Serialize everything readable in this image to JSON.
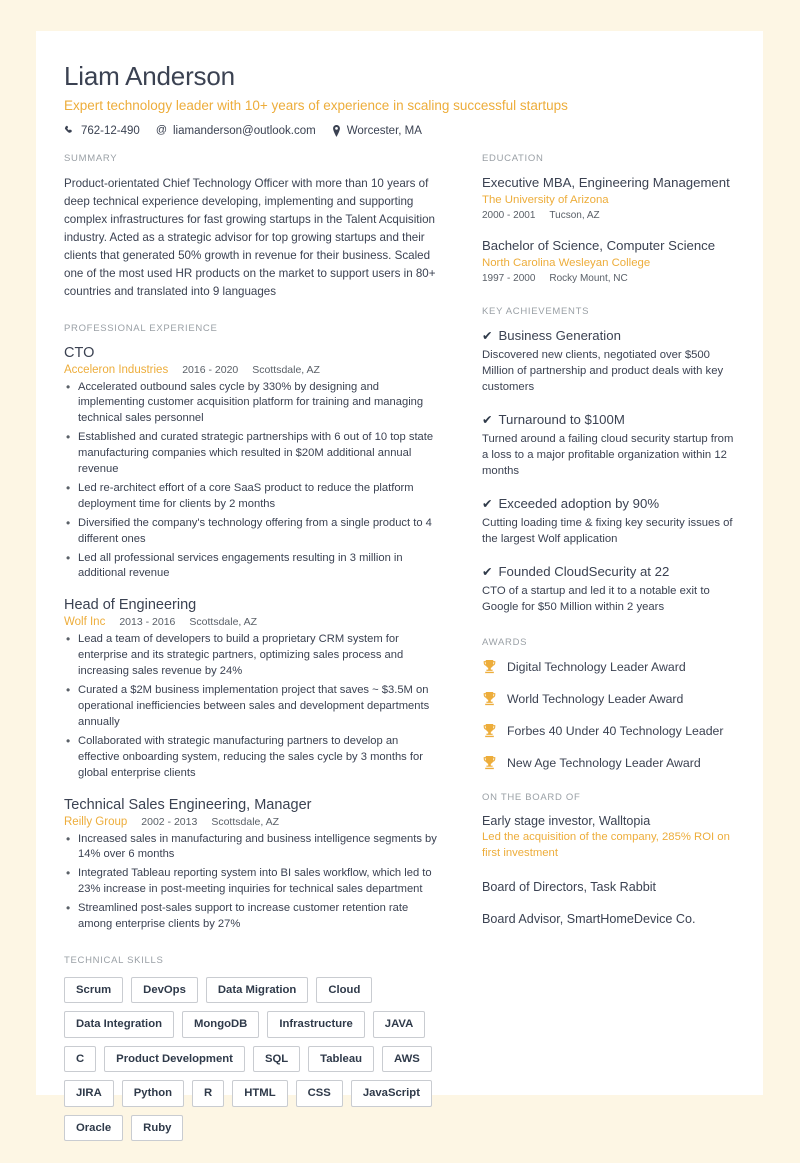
{
  "theme": {
    "page_background": "#fdf6e4",
    "card_background": "#ffffff",
    "accent": "#edad3b",
    "text": "#3b4252",
    "muted": "#9aa0a6"
  },
  "header": {
    "name": "Liam Anderson",
    "headline": "Expert technology leader with 10+ years of experience in scaling successful startups",
    "contacts": [
      {
        "icon": "phone-icon",
        "value": "762-12-490"
      },
      {
        "icon": "email-icon",
        "value": "liamanderson@outlook.com"
      },
      {
        "icon": "location-pin-icon",
        "value": "Worcester, MA"
      }
    ]
  },
  "left": {
    "summary": {
      "title": "SUMMARY",
      "text": "Product-orientated Chief Technology Officer with more than 10 years of deep technical experience developing, implementing and supporting complex infrastructures for fast growing startups in the Talent Acquisition industry. Acted as a strategic advisor for top growing startups and their clients that generated 50% growth in revenue for their business. Scaled one of the most used HR products on the market to support users in 80+ countries and translated into 9 languages"
    },
    "experience": {
      "title": "PROFESSIONAL EXPERIENCE",
      "jobs": [
        {
          "role": "CTO",
          "company": "Acceleron Industries",
          "dates": "2016 - 2020",
          "location": "Scottsdale, AZ",
          "bullets": [
            "Accelerated outbound sales cycle by 330% by designing and implementing customer acquisition platform for training and managing technical sales personnel",
            "Established and curated strategic partnerships with 6 out of 10 top state manufacturing companies which resulted in $20M additional annual revenue",
            "Led re-architect effort of a core SaaS product to reduce the platform deployment time for clients by 2 months",
            "Diversified the company's technology offering from a single product to 4 different ones",
            "Led all professional services engagements resulting in 3 million in additional revenue"
          ]
        },
        {
          "role": "Head of Engineering",
          "company": "Wolf Inc",
          "dates": "2013 - 2016",
          "location": "Scottsdale, AZ",
          "bullets": [
            "Lead a team of developers to build a proprietary CRM system for enterprise and its strategic partners, optimizing sales process and increasing sales revenue by 24%",
            "Curated a $2M business implementation project that saves ~ $3.5M on operational inefficiencies between sales and development departments annually",
            "Collaborated with strategic manufacturing partners to develop an effective onboarding system, reducing the sales cycle by 3 months for global enterprise clients"
          ]
        },
        {
          "role": "Technical Sales Engineering, Manager",
          "company": "Reilly Group",
          "dates": "2002 - 2013",
          "location": "Scottsdale, AZ",
          "bullets": [
            "Increased sales in manufacturing and business intelligence segments by 14% over 6 months",
            "Integrated Tableau reporting system into BI sales workflow, which led to 23% increase in post-meeting inquiries for technical sales department",
            "Streamlined post-sales support to increase customer retention rate among enterprise clients by 27%"
          ]
        }
      ]
    },
    "skills": {
      "title": "TECHNICAL SKILLS",
      "tags": [
        "Scrum",
        "DevOps",
        "Data Migration",
        "Cloud",
        "Data Integration",
        "MongoDB",
        "Infrastructure",
        "JAVA",
        "C",
        "Product Development",
        "SQL",
        "Tableau",
        "AWS",
        "JIRA",
        "Python",
        "R",
        "HTML",
        "CSS",
        "JavaScript",
        "Oracle",
        "Ruby"
      ]
    }
  },
  "right": {
    "education": {
      "title": "EDUCATION",
      "items": [
        {
          "degree": "Executive MBA, Engineering Management",
          "school": "The University of Arizona",
          "dates": "2000 - 2001",
          "location": "Tucson, AZ"
        },
        {
          "degree": "Bachelor of Science, Computer Science",
          "school": "North Carolina Wesleyan College",
          "dates": "1997 - 2000",
          "location": "Rocky Mount, NC"
        }
      ]
    },
    "achievements": {
      "title": "KEY ACHIEVEMENTS",
      "check_glyph": "✔",
      "items": [
        {
          "title": "Business Generation",
          "desc": "Discovered new clients, negotiated over $500 Million of partnership and product deals with key customers"
        },
        {
          "title": "Turnaround to $100M",
          "desc": "Turned around a failing cloud security startup from a loss to a major profitable organization within 12 months"
        },
        {
          "title": "Exceeded adoption by 90%",
          "desc": "Cutting loading time & fixing key security issues of the largest Wolf application"
        },
        {
          "title": "Founded CloudSecurity at 22",
          "desc": "CTO of a startup and led it to a notable exit to Google for $50 Million within 2 years"
        }
      ]
    },
    "awards": {
      "title": "AWARDS",
      "icon": "trophy-icon",
      "items": [
        "Digital Technology Leader Award",
        "World Technology Leader Award",
        "Forbes 40 Under 40 Technology Leader",
        "New Age Technology Leader Award"
      ]
    },
    "board": {
      "title": "ON THE BOARD OF",
      "items": [
        {
          "title": "Early stage investor, Walltopia",
          "desc": "Led the acquisition of the company, 285% ROI on first investment"
        },
        {
          "title": "Board of Directors, Task Rabbit",
          "desc": ""
        },
        {
          "title": "Board Advisor, SmartHomeDevice Co.",
          "desc": ""
        }
      ]
    }
  }
}
